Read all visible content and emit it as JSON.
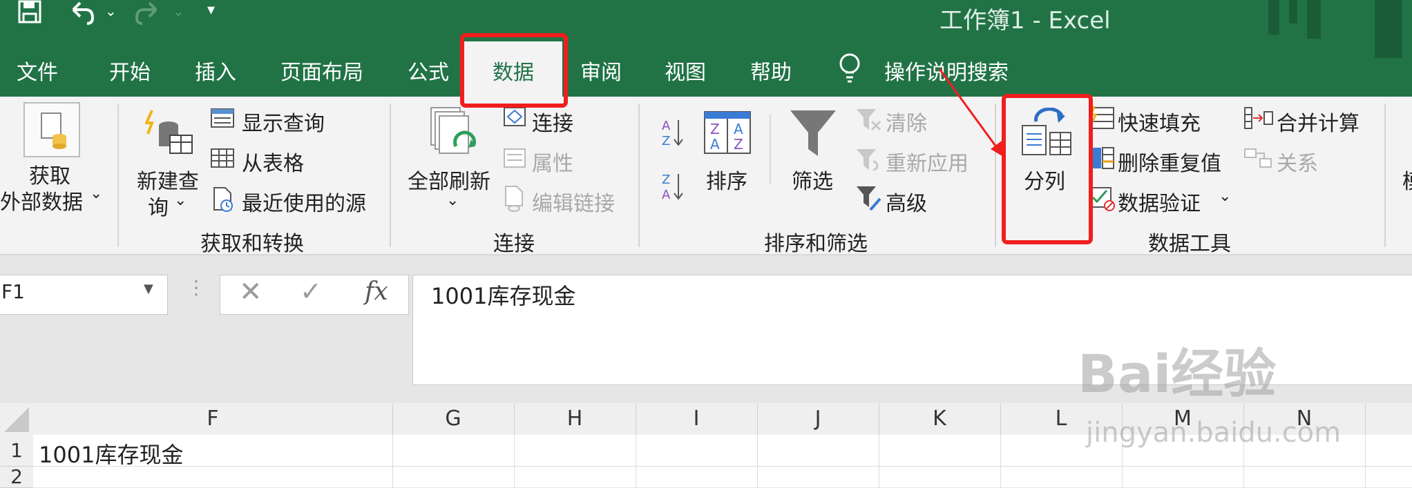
{
  "app": {
    "title": "工作簿1  -  Excel"
  },
  "tabs": [
    "文件",
    "开始",
    "插入",
    "页面布局",
    "公式",
    "数据",
    "审阅",
    "视图",
    "帮助"
  ],
  "active_tab": "数据",
  "tell_me": "操作说明搜索",
  "ribbon": {
    "get_transform": {
      "get_external": [
        "获取",
        "外部数据"
      ],
      "new_query": [
        "新建查",
        "询"
      ],
      "show_query": "显示查询",
      "from_table": "从表格",
      "recent_sources": "最近使用的源",
      "group_label": "获取和转换"
    },
    "connections": {
      "refresh_all": "全部刷新",
      "connections": "连接",
      "properties": "属性",
      "edit_links": "编辑链接",
      "group_label": "连接"
    },
    "sort_filter": {
      "sort": "排序",
      "filter": "筛选",
      "clear": "清除",
      "reapply": "重新应用",
      "advanced": "高级",
      "group_label": "排序和筛选"
    },
    "data_tools": {
      "text_to_columns": "分列",
      "flash_fill": "快速填充",
      "remove_duplicates": "删除重复值",
      "data_validation": "数据验证",
      "consolidate": "合并计算",
      "relationships": "关系",
      "group_label": "数据工具"
    },
    "partial_next": "模"
  },
  "formula_bar": {
    "name_box": "F1",
    "fx": "fx",
    "content": "1001库存现金"
  },
  "sheet": {
    "columns": [
      "F",
      "G",
      "H",
      "I",
      "J",
      "K",
      "L",
      "M",
      "N"
    ],
    "rows": [
      "1",
      "2"
    ],
    "cells": {
      "F1": "1001库存现金"
    }
  },
  "watermark": {
    "main": "Bai经验",
    "sub": "jingyan.baidu.com"
  },
  "colors": {
    "excel_green": "#217346",
    "highlight_red": "#f01e1e"
  }
}
